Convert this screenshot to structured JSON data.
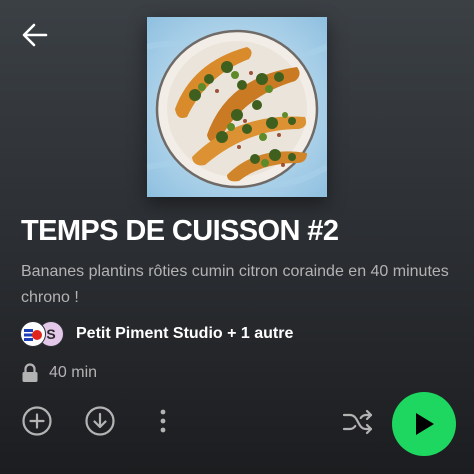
{
  "header": {
    "back_icon": "arrow-left-icon"
  },
  "episode": {
    "cover_icon": "plated-roasted-plantains-image",
    "title": "TEMPS DE CUISSON #2",
    "description": "Bananes plantins rôties cumin citron corainde en 40 minutes chrono !",
    "creators": "Petit Piment Studio + 1 autre",
    "second_avatar_letter": "S",
    "duration": "40 min",
    "duration_icon": "lock-icon"
  },
  "actions": {
    "add_icon": "add-circle-icon",
    "download_icon": "download-circle-icon",
    "more_icon": "more-vertical-icon",
    "shuffle_icon": "shuffle-icon",
    "play_icon": "play-icon"
  },
  "colors": {
    "accent": "#1ed760",
    "background_top": "#3b4045",
    "background_bottom": "#1c1d20",
    "secondary_text": "#b3b3b3"
  }
}
